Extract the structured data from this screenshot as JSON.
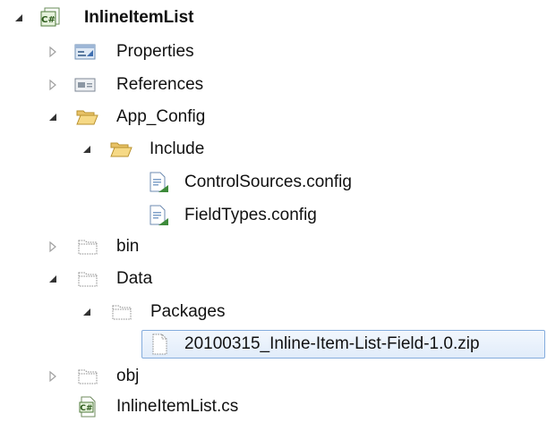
{
  "solution_explorer": {
    "root": {
      "label": "InlineItemList",
      "icon": "csharp-project-icon",
      "expanded": true
    },
    "items": [
      {
        "label": "Properties",
        "icon": "properties-icon",
        "expanded": false
      },
      {
        "label": "References",
        "icon": "references-icon",
        "expanded": false
      },
      {
        "label": "App_Config",
        "icon": "open-folder-icon",
        "expanded": true
      },
      {
        "label": "Include",
        "icon": "open-folder-icon",
        "expanded": true
      },
      {
        "label": "ControlSources.config",
        "icon": "config-file-icon"
      },
      {
        "label": "FieldTypes.config",
        "icon": "config-file-icon"
      },
      {
        "label": "bin",
        "icon": "excluded-folder-icon",
        "expanded": false
      },
      {
        "label": "Data",
        "icon": "excluded-folder-icon",
        "expanded": true
      },
      {
        "label": "Packages",
        "icon": "excluded-folder-icon",
        "expanded": true
      },
      {
        "label": "20100315_Inline-Item-List-Field-1.0.zip",
        "icon": "excluded-file-icon",
        "selected": true
      },
      {
        "label": "obj",
        "icon": "excluded-folder-icon",
        "expanded": false
      },
      {
        "label": "InlineItemList.cs",
        "icon": "csharp-file-icon"
      }
    ]
  },
  "colors": {
    "selection_border": "#84acdd",
    "selection_fill": "#e1ecfa",
    "folder_yellow": "#f4d27a",
    "arrow_dark": "#333333",
    "arrow_light": "#a0a0a0"
  }
}
